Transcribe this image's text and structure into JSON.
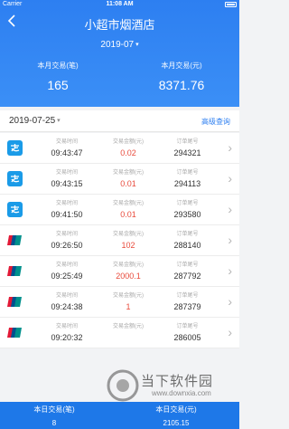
{
  "status_bar": {
    "carrier": "Carrier",
    "time": "11:08 AM"
  },
  "header": {
    "title": "小超市烟酒店",
    "month": "2019-07",
    "stats": [
      {
        "label": "本月交易(笔)",
        "value": "165"
      },
      {
        "label": "本月交易(元)",
        "value": "8371.76"
      }
    ]
  },
  "datebar": {
    "date": "2019-07-25",
    "advanced_query": "高级查询"
  },
  "list_headers": {
    "time": "交易时间",
    "amount": "交易金额(元)",
    "order": "订单尾号"
  },
  "rows": [
    {
      "icon": "alipay-icon",
      "time": "09:43:47",
      "amount": "0.02",
      "order": "294321"
    },
    {
      "icon": "alipay-icon",
      "time": "09:43:15",
      "amount": "0.01",
      "order": "294113"
    },
    {
      "icon": "alipay-icon",
      "time": "09:41:50",
      "amount": "0.01",
      "order": "293580"
    },
    {
      "icon": "unionpay-icon",
      "time": "09:26:50",
      "amount": "102",
      "order": "288140"
    },
    {
      "icon": "unionpay-icon",
      "time": "09:25:49",
      "amount": "2000.1",
      "order": "287792"
    },
    {
      "icon": "unionpay-icon",
      "time": "09:24:38",
      "amount": "1",
      "order": "287379"
    },
    {
      "icon": "unionpay-icon",
      "time": "09:20:32",
      "amount": "",
      "order": "286005"
    }
  ],
  "footer": [
    {
      "label": "本日交易(笔)",
      "value": "8"
    },
    {
      "label": "本日交易(元)",
      "value": "2105.15"
    }
  ],
  "watermark": {
    "text": "当下软件园",
    "sub": "www.downxia.com"
  },
  "colors": {
    "primary": "#2d7ff1",
    "amount": "#e94b3c",
    "alipay": "#1a9be8",
    "unionpay_red": "#e21836",
    "unionpay_blue": "#00508f",
    "unionpay_green": "#00908c"
  }
}
